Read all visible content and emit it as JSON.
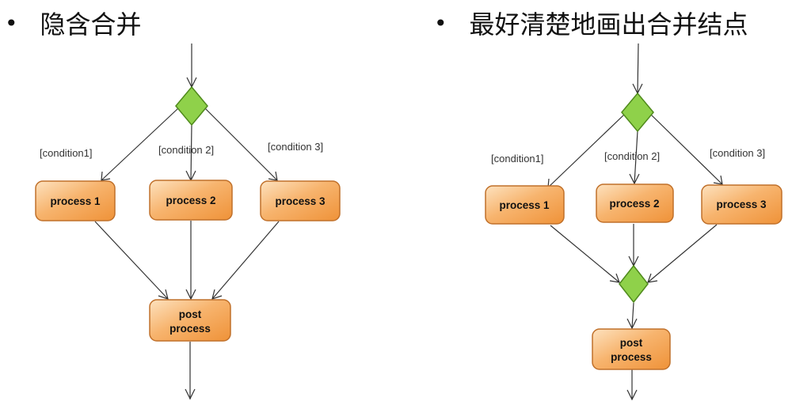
{
  "left_panel": {
    "bullet": "•",
    "title": "隐含合并",
    "conditions": [
      "[condition1]",
      "[condition 2]",
      "[condition 3]"
    ],
    "processes": [
      "process 1",
      "process 2",
      "process 3"
    ],
    "post_process": [
      "post",
      "process"
    ]
  },
  "right_panel": {
    "bullet": "•",
    "title": "最好清楚地画出合并结点",
    "conditions": [
      "[condition1]",
      "[condition 2]",
      "[condition 3]"
    ],
    "processes": [
      "process 1",
      "process 2",
      "process 3"
    ],
    "post_process": [
      "post",
      "process"
    ]
  },
  "colors": {
    "process_fill_light": "#fbd3a3",
    "process_fill_dark": "#f29a45",
    "decision_fill": "#8fd14a"
  }
}
